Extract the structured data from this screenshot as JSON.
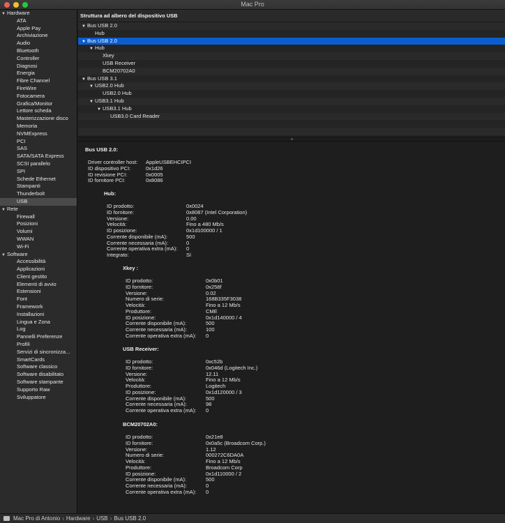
{
  "window": {
    "title": "Mac Pro"
  },
  "sidebar": {
    "groups": [
      {
        "label": "Hardware",
        "items": [
          "ATA",
          "Apple Pay",
          "Archiviazione",
          "Audio",
          "Bluetooth",
          "Controller",
          "Diagnosi",
          "Energia",
          "Fibre Channel",
          "FireWire",
          "Fotocamera",
          "Grafica/Monitor",
          "Lettore scheda",
          "Masterizzazione disco",
          "Memoria",
          "NVMExpress",
          "PCI",
          "SAS",
          "SATA/SATA Express",
          "SCSI parallelo",
          "SPI",
          "Schede Ethernet",
          "Stampanti",
          "Thunderbolt",
          "USB"
        ]
      },
      {
        "label": "Rete",
        "items": [
          "Firewall",
          "Posizioni",
          "Volumi",
          "WWAN",
          "Wi-Fi"
        ]
      },
      {
        "label": "Software",
        "items": [
          "Accessibilità",
          "Applicazioni",
          "Client gestito",
          "Elementi di avvio",
          "Estensioni",
          "Font",
          "Framework",
          "Installazioni",
          "Lingua e Zona",
          "Log",
          "Pannelli Preferenze",
          "Profili",
          "Servizi di sincronizza...",
          "SmartCards",
          "Software classico",
          "Software disabilitato",
          "Software stampante",
          "Supporto Raw",
          "Sviluppatore"
        ]
      }
    ],
    "selected": "USB"
  },
  "tree": {
    "header": "Struttura ad albero del dispositivo USB",
    "rows": [
      {
        "label": "Bus USB 2.0",
        "level": 0,
        "expanded": true
      },
      {
        "label": "Hub",
        "level": 1,
        "expanded": false
      },
      {
        "label": "Bus USB 2.0",
        "level": 0,
        "expanded": true,
        "selected": true
      },
      {
        "label": "Hub",
        "level": 1,
        "expanded": true
      },
      {
        "label": "Xkey",
        "level": 2,
        "expanded": false
      },
      {
        "label": "USB Receiver",
        "level": 2,
        "expanded": false
      },
      {
        "label": "BCM20702A0",
        "level": 2,
        "expanded": false
      },
      {
        "label": "Bus USB 3.1",
        "level": 0,
        "expanded": true
      },
      {
        "label": "USB2.0 Hub",
        "level": 1,
        "expanded": true
      },
      {
        "label": "USB2.0 Hub",
        "level": 2,
        "expanded": false
      },
      {
        "label": "USB3.1 Hub",
        "level": 1,
        "expanded": true
      },
      {
        "label": "USB3.1 Hub",
        "level": 2,
        "expanded": true
      },
      {
        "label": "USB3.0 Card Reader",
        "level": 3,
        "expanded": false
      },
      {
        "label": "",
        "level": 0,
        "expanded": false
      },
      {
        "label": "",
        "level": 0,
        "expanded": false
      },
      {
        "label": "",
        "level": 0,
        "expanded": false
      }
    ]
  },
  "detail": {
    "bus": {
      "title": "Bus USB 2.0:",
      "fields": [
        [
          "Driver controller host:",
          "AppleUSBEHCIPCI"
        ],
        [
          "ID dispositivo PCI:",
          "0x1d26"
        ],
        [
          "ID revisione PCI:",
          "0x0005"
        ],
        [
          "ID fornitore PCI:",
          "0x8086"
        ]
      ]
    },
    "hub": {
      "title": "Hub:",
      "fields": [
        [
          "ID prodotto:",
          "0x0024"
        ],
        [
          "ID fornitore:",
          "0x8087  (Intel Corporation)"
        ],
        [
          "Versione:",
          "0.00"
        ],
        [
          "Velocità:",
          "Fino a 480 Mb/s"
        ],
        [
          "ID posizione:",
          "0x1d100000 / 1"
        ],
        [
          "Corrente disponibile (mA):",
          "500"
        ],
        [
          "Corrente necessaria (mA):",
          "0"
        ],
        [
          "Corrente operativa extra (mA):",
          "0"
        ],
        [
          "Integrato:",
          "Sì"
        ]
      ]
    },
    "devices": [
      {
        "title": "Xkey :",
        "fields": [
          [
            "ID prodotto:",
            "0x0b01"
          ],
          [
            "ID fornitore:",
            "0x258f"
          ],
          [
            "Versione:",
            "0.02"
          ],
          [
            "Numero di serie:",
            "168B335F3038"
          ],
          [
            "Velocità:",
            "Fino a 12 Mb/s"
          ],
          [
            "Produttore:",
            "CME"
          ],
          [
            "ID posizione:",
            "0x1d140000 / 4"
          ],
          [
            "Corrente disponibile (mA):",
            "500"
          ],
          [
            "Corrente necessaria (mA):",
            "100"
          ],
          [
            "Corrente operativa extra (mA):",
            "0"
          ]
        ]
      },
      {
        "title": "USB Receiver:",
        "fields": [
          [
            "ID prodotto:",
            "0xc52b"
          ],
          [
            "ID fornitore:",
            "0x046d  (Logitech Inc.)"
          ],
          [
            "Versione:",
            "12.11"
          ],
          [
            "Velocità:",
            "Fino a 12 Mb/s"
          ],
          [
            "Produttore:",
            "Logitech"
          ],
          [
            "ID posizione:",
            "0x1d120000 / 3"
          ],
          [
            "Corrente disponibile (mA):",
            "500"
          ],
          [
            "Corrente necessaria (mA):",
            "98"
          ],
          [
            "Corrente operativa extra (mA):",
            "0"
          ]
        ]
      },
      {
        "title": "BCM20702A0:",
        "fields": [
          [
            "ID prodotto:",
            "0x21e8"
          ],
          [
            "ID fornitore:",
            "0x0a5c  (Broadcom Corp.)"
          ],
          [
            "Versione:",
            "1.12"
          ],
          [
            "Numero di serie:",
            "000272C6DA0A"
          ],
          [
            "Velocità:",
            "Fino a 12 Mb/s"
          ],
          [
            "Produttore:",
            "Broadcom Corp"
          ],
          [
            "ID posizione:",
            "0x1d110000 / 2"
          ],
          [
            "Corrente disponibile (mA):",
            "500"
          ],
          [
            "Corrente necessaria (mA):",
            "0"
          ],
          [
            "Corrente operativa extra (mA):",
            "0"
          ]
        ]
      }
    ]
  },
  "statusbar": {
    "breadcrumbs": [
      "Mac Pro di Antonio",
      "Hardware",
      "USB",
      "Bus USB 2.0"
    ],
    "separator": "›"
  }
}
